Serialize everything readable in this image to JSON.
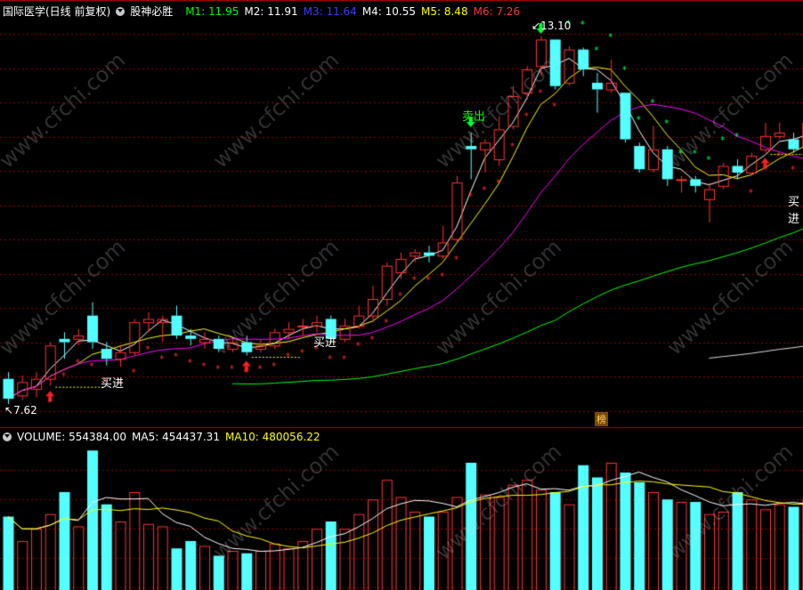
{
  "header": {
    "stock": "国际医学(日线 前复权)",
    "indicator": "股神必胜",
    "ma_readout": [
      {
        "label": "M1: 11.95",
        "color": "#00ff00"
      },
      {
        "label": "M2: 11.91",
        "color": "#ffffff"
      },
      {
        "label": "M3: 11.64",
        "color": "#0000ff"
      },
      {
        "label": "M4: 10.55",
        "color": "#ffffff"
      },
      {
        "label": "M5: 8.48",
        "color": "#ffff00"
      },
      {
        "label": "M6: 7.26",
        "color": "#ff3232"
      }
    ]
  },
  "volume_header": {
    "title": "VOLUME: 554384.00",
    "ma5": "MA5: 454437.31",
    "ma10": "MA10: 480056.22"
  },
  "annotations": {
    "low_price": "7.62",
    "high_price": "13.10",
    "buy": "买进",
    "sell": "卖出",
    "badge": "榜"
  },
  "watermark": "www.cfchi.com",
  "colors": {
    "up": "#ff3232",
    "down": "#54ffff",
    "grid": "#8c0000",
    "ma_short": "#ffffff",
    "ma_mid": "#ffff00",
    "ma_long": "#ff00ff",
    "ma_longer": "#00ff00",
    "ma_longest": "#dddddd"
  },
  "chart_data": {
    "type": "candlestick",
    "price_range": [
      7.3,
      13.4
    ],
    "candles": [
      {
        "o": 8.0,
        "c": 7.7,
        "h": 8.1,
        "l": 7.62
      },
      {
        "o": 7.75,
        "c": 7.95,
        "h": 8.05,
        "l": 7.68
      },
      {
        "o": 7.85,
        "c": 8.0,
        "h": 8.1,
        "l": 7.72
      },
      {
        "o": 8.0,
        "c": 8.5,
        "h": 8.55,
        "l": 7.9
      },
      {
        "o": 8.6,
        "c": 8.55,
        "h": 8.7,
        "l": 8.3
      },
      {
        "o": 8.6,
        "c": 8.65,
        "h": 8.75,
        "l": 8.5
      },
      {
        "o": 8.95,
        "c": 8.55,
        "h": 9.15,
        "l": 8.45
      },
      {
        "o": 8.45,
        "c": 8.3,
        "h": 8.55,
        "l": 8.2
      },
      {
        "o": 8.3,
        "c": 8.4,
        "h": 8.5,
        "l": 8.18
      },
      {
        "o": 8.4,
        "c": 8.85,
        "h": 8.9,
        "l": 8.35
      },
      {
        "o": 8.85,
        "c": 8.9,
        "h": 9.0,
        "l": 8.7
      },
      {
        "o": 8.85,
        "c": 8.9,
        "h": 8.95,
        "l": 8.55
      },
      {
        "o": 8.95,
        "c": 8.65,
        "h": 9.1,
        "l": 8.6
      },
      {
        "o": 8.65,
        "c": 8.6,
        "h": 8.75,
        "l": 8.5
      },
      {
        "o": 8.55,
        "c": 8.6,
        "h": 8.7,
        "l": 8.45
      },
      {
        "o": 8.6,
        "c": 8.45,
        "h": 8.65,
        "l": 8.4
      },
      {
        "o": 8.45,
        "c": 8.55,
        "h": 8.6,
        "l": 8.4
      },
      {
        "o": 8.55,
        "c": 8.4,
        "h": 8.65,
        "l": 8.35
      },
      {
        "o": 8.45,
        "c": 8.5,
        "h": 8.6,
        "l": 8.4
      },
      {
        "o": 8.5,
        "c": 8.7,
        "h": 8.75,
        "l": 8.45
      },
      {
        "o": 8.7,
        "c": 8.75,
        "h": 8.85,
        "l": 8.6
      },
      {
        "o": 8.8,
        "c": 8.8,
        "h": 8.9,
        "l": 8.65
      },
      {
        "o": 8.8,
        "c": 8.85,
        "h": 8.95,
        "l": 8.7
      },
      {
        "o": 8.9,
        "c": 8.6,
        "h": 8.95,
        "l": 8.55
      },
      {
        "o": 8.6,
        "c": 8.8,
        "h": 8.9,
        "l": 8.55
      },
      {
        "o": 8.8,
        "c": 8.95,
        "h": 9.1,
        "l": 8.75
      },
      {
        "o": 8.95,
        "c": 9.2,
        "h": 9.4,
        "l": 8.85
      },
      {
        "o": 9.2,
        "c": 9.7,
        "h": 9.75,
        "l": 9.1
      },
      {
        "o": 9.6,
        "c": 9.8,
        "h": 9.9,
        "l": 9.5
      },
      {
        "o": 9.85,
        "c": 9.9,
        "h": 9.95,
        "l": 9.75
      },
      {
        "o": 9.9,
        "c": 9.85,
        "h": 10.0,
        "l": 9.75
      },
      {
        "o": 9.85,
        "c": 10.05,
        "h": 10.3,
        "l": 9.8
      },
      {
        "o": 10.1,
        "c": 10.95,
        "h": 11.05,
        "l": 10.05
      },
      {
        "o": 11.5,
        "c": 11.45,
        "h": 11.7,
        "l": 11.0
      },
      {
        "o": 11.45,
        "c": 11.55,
        "h": 11.6,
        "l": 11.1
      },
      {
        "o": 11.3,
        "c": 11.75,
        "h": 11.95,
        "l": 11.2
      },
      {
        "o": 11.8,
        "c": 12.25,
        "h": 12.4,
        "l": 11.75
      },
      {
        "o": 12.3,
        "c": 12.65,
        "h": 12.7,
        "l": 12.2
      },
      {
        "o": 12.7,
        "c": 13.1,
        "h": 13.15,
        "l": 12.55
      },
      {
        "o": 13.1,
        "c": 12.4,
        "h": 13.1,
        "l": 12.35
      },
      {
        "o": 12.45,
        "c": 12.95,
        "h": 13.0,
        "l": 12.4
      },
      {
        "o": 12.95,
        "c": 12.65,
        "h": 12.98,
        "l": 12.55
      },
      {
        "o": 12.45,
        "c": 12.35,
        "h": 12.6,
        "l": 12.0
      },
      {
        "o": 12.35,
        "c": 12.45,
        "h": 12.8,
        "l": 12.3
      },
      {
        "o": 12.3,
        "c": 11.6,
        "h": 12.3,
        "l": 11.55
      },
      {
        "o": 11.5,
        "c": 11.15,
        "h": 11.55,
        "l": 11.1
      },
      {
        "o": 11.15,
        "c": 11.45,
        "h": 11.8,
        "l": 11.1
      },
      {
        "o": 11.45,
        "c": 11.0,
        "h": 11.5,
        "l": 10.9
      },
      {
        "o": 11.0,
        "c": 11.0,
        "h": 11.05,
        "l": 10.8
      },
      {
        "o": 11.0,
        "c": 10.9,
        "h": 11.05,
        "l": 10.8
      },
      {
        "o": 10.7,
        "c": 10.85,
        "h": 10.95,
        "l": 10.35
      },
      {
        "o": 10.9,
        "c": 11.2,
        "h": 11.25,
        "l": 10.85
      },
      {
        "o": 11.2,
        "c": 11.1,
        "h": 11.3,
        "l": 11.0
      },
      {
        "o": 11.1,
        "c": 11.35,
        "h": 11.4,
        "l": 11.05
      },
      {
        "o": 11.45,
        "c": 11.65,
        "h": 11.85,
        "l": 11.4
      },
      {
        "o": 11.65,
        "c": 11.7,
        "h": 11.85,
        "l": 11.6
      },
      {
        "o": 11.6,
        "c": 11.45,
        "h": 11.7,
        "l": 11.4
      },
      {
        "o": 11.5,
        "c": 11.85,
        "h": 11.9,
        "l": 11.4
      },
      {
        "o": 11.85,
        "c": 11.95,
        "h": 12.05,
        "l": 11.75
      }
    ],
    "volume": [
      300,
      200,
      250,
      310,
      400,
      260,
      570,
      350,
      280,
      400,
      270,
      260,
      170,
      200,
      180,
      140,
      160,
      150,
      160,
      190,
      170,
      200,
      250,
      280,
      250,
      310,
      370,
      450,
      380,
      320,
      300,
      320,
      380,
      520,
      390,
      380,
      430,
      450,
      410,
      400,
      350,
      510,
      460,
      520,
      480,
      440,
      400,
      370,
      360,
      360,
      310,
      320,
      400,
      370,
      330,
      350,
      340,
      370,
      380
    ],
    "signals": [
      {
        "i": 3,
        "type": "buy"
      },
      {
        "i": 17,
        "type": "buy"
      },
      {
        "i": 33,
        "type": "sell"
      },
      {
        "i": 38,
        "type": "sell-top"
      },
      {
        "i": 54,
        "type": "buy"
      }
    ]
  }
}
